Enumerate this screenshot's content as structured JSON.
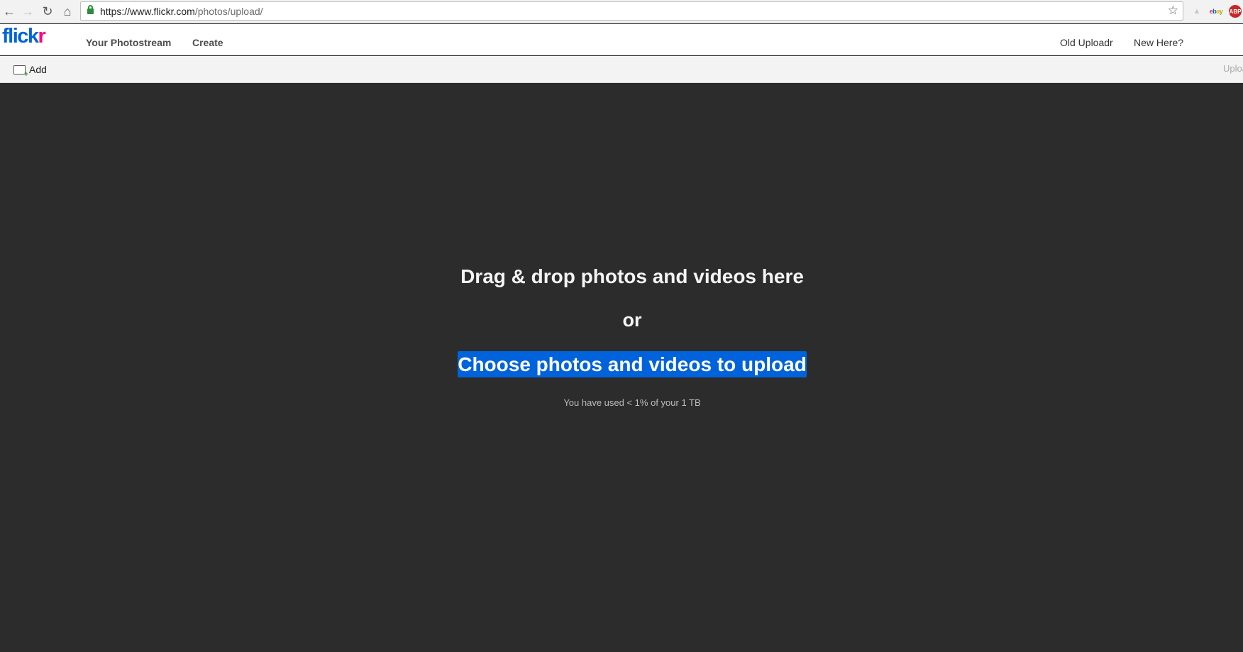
{
  "browser": {
    "url_host": "https://www.flickr.com",
    "url_path": "/photos/upload/",
    "extensions": [
      "adblock-icon",
      "ebay-icon",
      "security-badge-icon"
    ],
    "ebay_label": [
      "e",
      "b",
      "a",
      "y"
    ],
    "badge_label": "ABP"
  },
  "header": {
    "logo_main": "flick",
    "logo_accent": "r",
    "nav": {
      "photostream": "Your Photostream",
      "create": "Create"
    },
    "right": {
      "old_uploadr": "Old Uploadr",
      "new_here": "New Here?"
    }
  },
  "toolbar": {
    "add_label": "Add",
    "upload_partial": "Uploa"
  },
  "drop_zone": {
    "title": "Drag & drop photos and videos here",
    "or": "or",
    "choose_button": "Choose photos and videos to upload",
    "quota": "You have used < 1% of your 1 TB"
  },
  "colors": {
    "brand_blue": "#0063dc",
    "brand_pink": "#ff0084",
    "drop_bg": "#2c2c2c"
  }
}
